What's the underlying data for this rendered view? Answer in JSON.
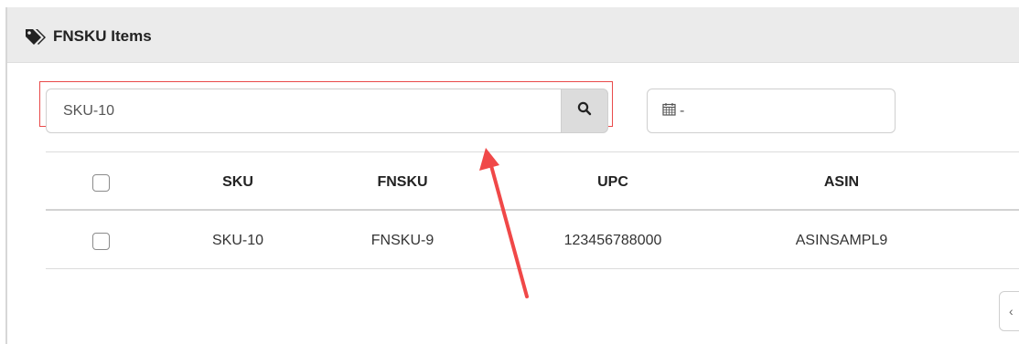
{
  "panel": {
    "title": "FNSKU Items",
    "title_icon": "tags-icon"
  },
  "search": {
    "value": "SKU-10",
    "button_icon": "search-icon"
  },
  "date_range": {
    "icon": "calendar-icon",
    "value": "-"
  },
  "table": {
    "columns": [
      "SKU",
      "FNSKU",
      "UPC",
      "ASIN"
    ],
    "rows": [
      {
        "sku": "SKU-10",
        "fnsku": "FNSKU-9",
        "upc": "123456788000",
        "asin": "ASINSAMPL9"
      }
    ]
  },
  "pagination": {
    "prev_label": "‹"
  },
  "colors": {
    "highlight": "#e94a4a",
    "header_bg": "#ebebeb",
    "search_button_bg": "#dcdcdc"
  }
}
